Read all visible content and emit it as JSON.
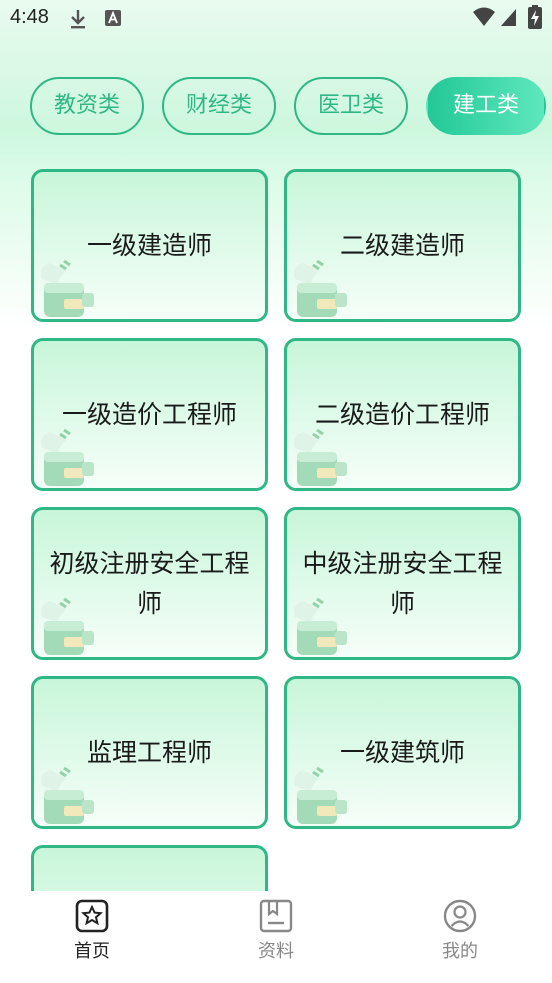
{
  "status_bar": {
    "time": "4:48"
  },
  "tabs": [
    {
      "label": "教资类",
      "active": false
    },
    {
      "label": "财经类",
      "active": false
    },
    {
      "label": "医卫类",
      "active": false
    },
    {
      "label": "建工类",
      "active": true
    }
  ],
  "cards": [
    {
      "title": "一级建造师"
    },
    {
      "title": "二级建造师"
    },
    {
      "title": "一级造价工程师"
    },
    {
      "title": "二级造价工程师"
    },
    {
      "title": "初级注册安全工程师"
    },
    {
      "title": "中级注册安全工程师"
    },
    {
      "title": "监理工程师"
    },
    {
      "title": "一级建筑师"
    },
    {
      "title": ""
    }
  ],
  "bottom_nav": [
    {
      "label": "首页",
      "icon": "home-star-icon",
      "active": true
    },
    {
      "label": "资料",
      "icon": "bookmark-doc-icon",
      "active": false
    },
    {
      "label": "我的",
      "icon": "user-icon",
      "active": false
    }
  ],
  "colors": {
    "accent": "#2fb786",
    "accent_gradient_start": "#22c896",
    "accent_gradient_end": "#5ee7bd"
  }
}
